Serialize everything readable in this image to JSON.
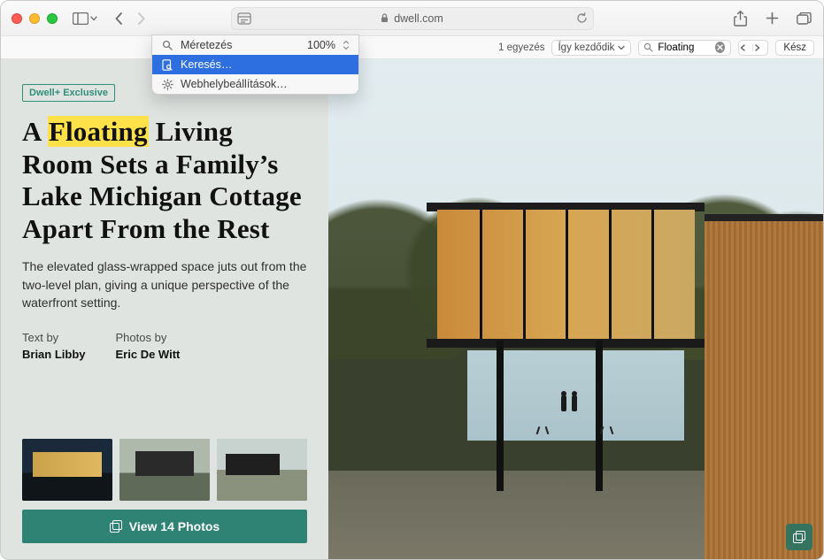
{
  "browser": {
    "url_host": "dwell.com",
    "dropdown": {
      "zoom_label": "Méretezés",
      "zoom_value": "100%",
      "find_label": "Keresés…",
      "settings_label": "Webhelybeállítások…"
    }
  },
  "find": {
    "match_count": "1 egyezés",
    "mode_label": "Így kezdődik",
    "search_value": "Floating",
    "done_label": "Kész"
  },
  "article": {
    "badge": "Dwell+ Exclusive",
    "headline_pre": "A ",
    "headline_highlight": "Floating",
    "headline_post": " Living Room Sets a Family’s Lake Michigan Cottage Apart From the Rest",
    "dek": "The elevated glass-wrapped space juts out from the two-level plan, giving a unique perspective of the waterfront setting.",
    "text_by_label": "Text by",
    "text_by_value": "Brian Libby",
    "photos_by_label": "Photos by",
    "photos_by_value": "Eric De Witt",
    "view_photos_label": "View 14 Photos"
  }
}
